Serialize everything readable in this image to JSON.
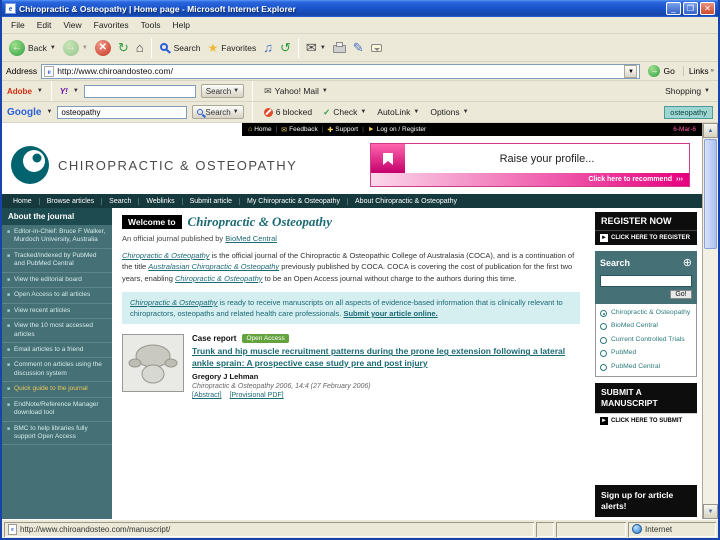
{
  "colors": {
    "accent_teal": "#1b6a74",
    "sidebar_teal": "#447076",
    "nav_dark": "#15393d",
    "accent_magenta": "#e6007e",
    "xp_blue": "#1c55cc"
  },
  "window": {
    "title": "Chiropractic & Osteopathy | Home page - Microsoft Internet Explorer"
  },
  "menubar": {
    "items": [
      "File",
      "Edit",
      "View",
      "Favorites",
      "Tools",
      "Help"
    ]
  },
  "toolbar": {
    "back": "Back",
    "search": "Search",
    "favorites": "Favorites"
  },
  "addressbar": {
    "label": "Address",
    "url": "http://www.chiroandosteo.com/",
    "go": "Go",
    "links": "Links"
  },
  "yahoo_bar": {
    "adobe": "Adobe",
    "logo": "Y!",
    "search": "Search",
    "mail": "Yahoo! Mail",
    "shopping": "Shopping"
  },
  "google_bar": {
    "logo": "Google",
    "query": "osteopathy",
    "search": "Search",
    "blocked": "6 blocked",
    "check": "Check",
    "autolink": "AutoLink",
    "options": "Options",
    "highlight": "osteopathy"
  },
  "page": {
    "topbar": {
      "home": "Home",
      "feedback": "Feedback",
      "support": "Support",
      "logon": "Log on / Register",
      "date": "6-Mar-6"
    },
    "masthead": {
      "brand": "CHIROPRACTIC & OSTEOPATHY",
      "banner_title": "Raise your profile...",
      "banner_cta": "Click here to recommend",
      "banner_arrows": "›››"
    },
    "nav": {
      "items": [
        "Home",
        "Browse articles",
        "Search",
        "Weblinks",
        "Submit article",
        "My Chiropractic & Osteopathy",
        "About Chiropractic & Osteopathy"
      ]
    },
    "sidebar": {
      "title": "About the journal",
      "items": [
        "Editor-in-Chief: Bruce F Walker, Murdoch University, Australia",
        "Tracked/indexed by PubMed and PubMed Central",
        "View the editorial board",
        "Open Access to all articles",
        "View recent articles",
        "View the 10 most accessed articles",
        "Email articles to a friend",
        "Comment on articles using the discussion system",
        "Quick guide to the journal",
        "EndNote/Reference Manager download tool",
        "BMC to help libraries fully support Open Access"
      ]
    },
    "main": {
      "welcome_prefix": "Welcome to",
      "journal_name": "Chiropractic & Osteopathy",
      "subtitle_prefix": "An official journal published by",
      "publisher": "BioMed Central",
      "intro_segments": [
        "Chiropractic & Osteopathy",
        " is the official journal of the Chiropractic & Osteopathic College of Australasia (COCA), and is a continuation of the title ",
        "Australasian Chiropractic & Osteopathy",
        " previously published by COCA. COCA is covering the cost of publication for the first two years, enabling ",
        "Chiropractic & Osteopathy",
        " to be an Open Access journal without charge to the authors during this time."
      ],
      "highlight_segments": [
        "Chiropractic & Osteopathy",
        " is ready to receive manuscripts on all aspects of evidence-based information that is clinically relevant to chiropractors, osteopaths and related health care professionals. ",
        "Submit your article online."
      ],
      "article": {
        "label": "Case report",
        "badge": "Open Access",
        "title": "Trunk and hip muscle recruitment patterns during the prone leg extension following a lateral ankle sprain: A prospective case study pre and post injury",
        "author": "Gregory J Lehman",
        "citation": "Chiropractic & Osteopathy 2006, 14:4 (27 February 2006)",
        "link_abstract": "[Abstract]",
        "link_pdf": "[Provisional PDF]"
      }
    },
    "rightbar": {
      "register_title": "REGISTER NOW",
      "register_cta": "CLICK HERE TO REGISTER",
      "search_title": "Search",
      "go": "Go!",
      "options": [
        "Chiropractic & Osteopathy",
        "BioMed Central",
        "Current Controlled Trials",
        "PubMed",
        "PubMed Central"
      ],
      "submit_title": "SUBMIT A MANUSCRIPT",
      "submit_cta": "CLICK HERE TO SUBMIT",
      "alerts": "Sign up for article alerts!"
    }
  },
  "statusbar": {
    "url": "http://www.chiroandosteo.com/manuscript/",
    "zone": "Internet"
  }
}
